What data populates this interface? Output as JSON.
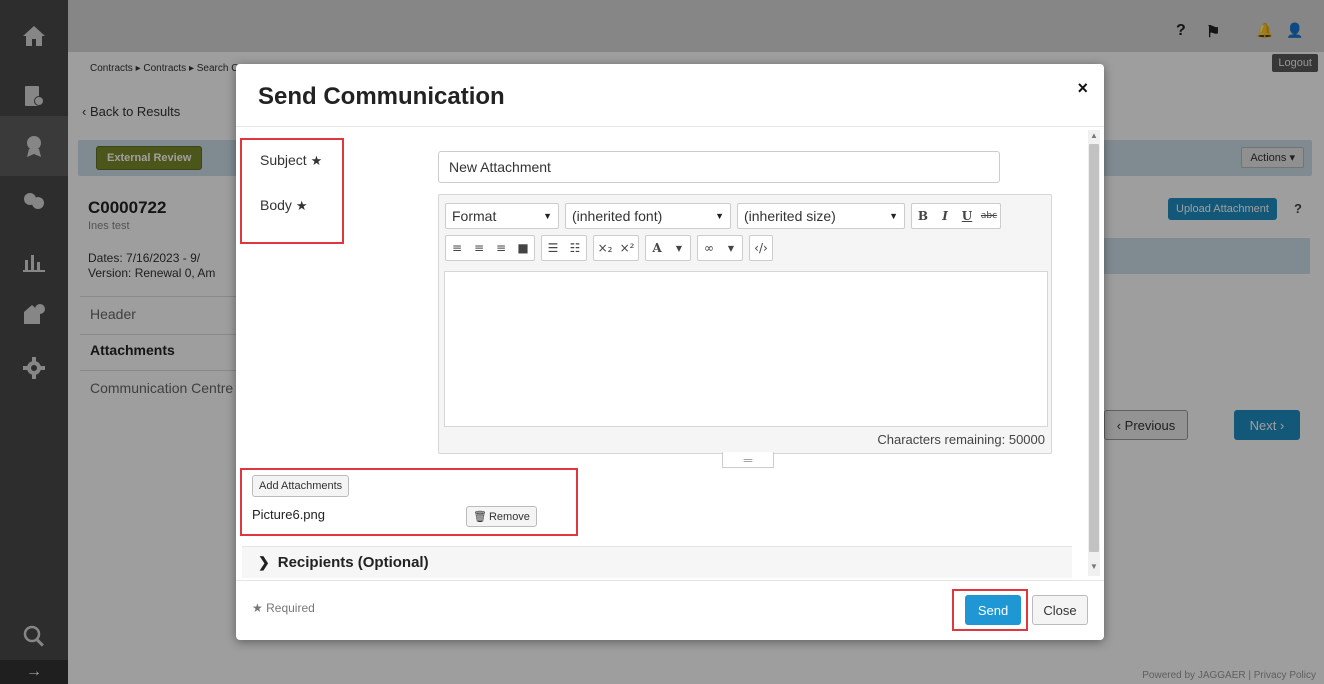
{
  "sidebar": {
    "icons": [
      "home-icon",
      "contracts-icon",
      "award-icon",
      "suppliers-icon",
      "reports-icon",
      "admin-icon",
      "settings-icon",
      "search-icon"
    ],
    "collapse_glyph": "→"
  },
  "topbar": {
    "help_glyph": "?",
    "flag_glyph": "⚑",
    "bell_glyph": "🔔",
    "user_glyph": "👤",
    "logout_label": "Logout"
  },
  "breadcrumb": "Contracts ▸ Contracts ▸ Search Contracts",
  "back_link": "‹ Back to Results",
  "status_badge": "External Review",
  "actions_label": "Actions ▾",
  "contract": {
    "id": "C0000722",
    "owner": "Ines test",
    "dates": "Dates:    7/16/2023 - 9/",
    "version": "Version:   Renewal 0, Am"
  },
  "nav": [
    "Header",
    "Attachments",
    "Communication Centre"
  ],
  "upload_attachment_label": "Upload Attachment",
  "help_label": "?",
  "previous_label": "‹ Previous",
  "next_label": "Next ›",
  "footer": "Powered by JAGGAER | Privacy Policy",
  "modal": {
    "title": "Send Communication",
    "close_glyph": "×",
    "subject_label": "Subject",
    "body_label": "Body",
    "required_star": "★",
    "subject_value": "New Attachment",
    "editor": {
      "format_label": "Format",
      "font_label": "(inherited font)",
      "size_label": "(inherited size)",
      "bold": "B",
      "italic": "I",
      "underline": "U",
      "strike": "abc",
      "subscript": "×₂",
      "superscript": "×²",
      "text_color": "A",
      "source": "‹/›",
      "chars_remaining": "Characters remaining: 50000"
    },
    "add_attachments_label": "Add Attachments",
    "file_name": "Picture6.png",
    "remove_label": "Remove",
    "recipients_label": "Recipients (Optional)",
    "required_note": "Required",
    "send_label": "Send",
    "close_label": "Close"
  },
  "colors": {
    "highlight_box": "#e0373f",
    "primary_button": "#1f97d4",
    "sidebar": "#4a4a4a"
  }
}
